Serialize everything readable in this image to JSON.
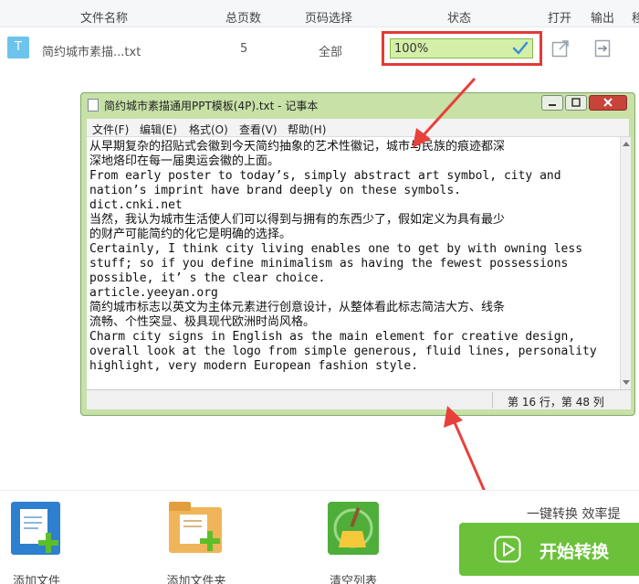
{
  "columns": {
    "file_name": "文件名称",
    "total_pages": "总页数",
    "page_select": "页码选择",
    "status": "状态",
    "open": "打开",
    "output": "输出",
    "extra": "移"
  },
  "file": {
    "type_letter": "T",
    "name": "简约城市素描...txt",
    "total_pages": "5",
    "page_select": "全部",
    "progress_text": "100%",
    "progress": 1.0
  },
  "notepad": {
    "title": "简约城市素描通用PPT模板(4P).txt - 记事本",
    "menu": [
      "文件(F)",
      "编辑(E)",
      "格式(O)",
      "查看(V)",
      "帮助(H)"
    ],
    "lines": [
      "从早期复杂的招贴式会徽到今天简约抽象的艺术性徽记，城市与民族的痕迹都深",
      "深地烙印在每一届奥运会徽的上面。",
      "From early poster to today’s, simply abstract art symbol, city and",
      "nation’s imprint have brand deeply on these symbols.",
      "dict.cnki.net",
      "当然，我认为城市生活使人们可以得到与拥有的东西少了，假如定义为具有最少",
      "的财产可能简约的化它是明确的选择。",
      "Certainly, I think city living enables one to get by with owning less",
      "stuff; so if you define minimalism as having the fewest possessions",
      "possible, it’ s the clear choice.",
      "article.yeeyan.org",
      "简约城市标志以英文为主体元素进行创意设计，从整体看此标志简洁大方、线条",
      "流畅、个性突显、极具现代欧洲时尚风格。",
      "Charm city signs in English as the main element for creative design,",
      "overall look at the logo from simple generous, fluid lines, personality",
      "highlight, very modern European fashion style."
    ],
    "status": "第 16 行，第 48 列"
  },
  "toolbar": {
    "add_file": "添加文件",
    "add_folder": "添加文件夹",
    "clear_list": "清空列表",
    "tip": "一键转换  效率提",
    "start": "开始转换"
  },
  "colors": {
    "accent_green": "#6bc13a",
    "highlight_red": "#e23b36",
    "notepad_frame": "#c7e1a7"
  }
}
